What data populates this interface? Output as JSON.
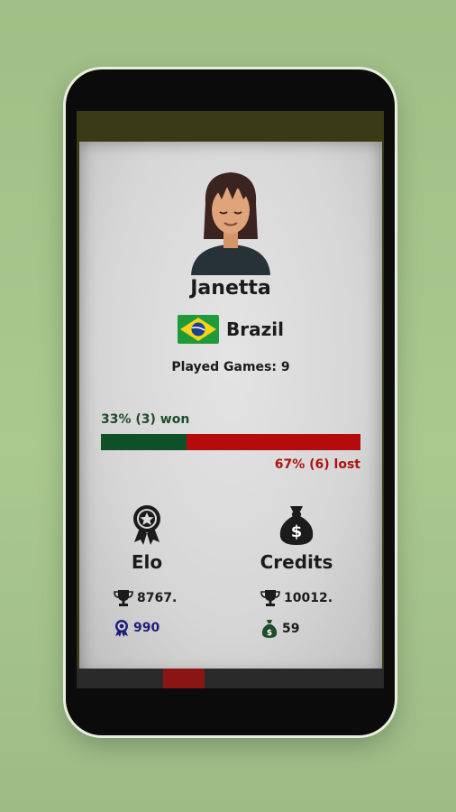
{
  "profile": {
    "name": "Janetta",
    "country": "Brazil",
    "played_games": "Played Games: 9"
  },
  "results": {
    "won_label": "33% (3) won",
    "lost_label": "67% (6) lost",
    "won_fraction": 0.33
  },
  "elo": {
    "title": "Elo",
    "total": "8767.",
    "value": "990"
  },
  "credits": {
    "title": "Credits",
    "total": "10012.",
    "value": "59"
  },
  "colors": {
    "won": "#0f5127",
    "lost": "#b40c0c",
    "elo_value": "#1f1f7a",
    "money_bag": "#1e4d2b"
  },
  "icons": {
    "elo": "award-ribbon-icon",
    "credits": "money-bag-icon",
    "total": "trophy-icon"
  }
}
